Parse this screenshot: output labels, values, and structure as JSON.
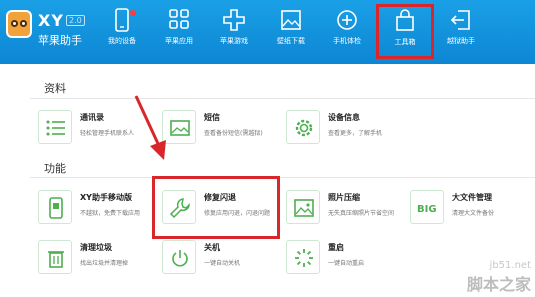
{
  "brand": {
    "name": "XY",
    "version": "2.0",
    "subtitle": "苹果助手"
  },
  "nav": [
    {
      "label": "我的设备",
      "icon": "device-icon"
    },
    {
      "label": "苹果应用",
      "icon": "apps-grid-icon"
    },
    {
      "label": "苹果游戏",
      "icon": "game-cross-icon"
    },
    {
      "label": "壁纸下载",
      "icon": "wallpaper-icon"
    },
    {
      "label": "手机体检",
      "icon": "health-check-icon"
    },
    {
      "label": "工具箱",
      "icon": "toolbox-icon",
      "active": true
    },
    {
      "label": "越狱助手",
      "icon": "jailbreak-exit-icon"
    }
  ],
  "sections": {
    "data_title": "资料",
    "function_title": "功能"
  },
  "tools": {
    "contacts": {
      "name": "通讯录",
      "desc": "轻松管理手机联系人",
      "icon": "contacts-list-icon"
    },
    "sms": {
      "name": "短信",
      "desc": "查看备份短信(需越狱)",
      "icon": "sms-image-icon"
    },
    "device_info": {
      "name": "设备信息",
      "desc": "查看更多，了解手机",
      "icon": "gear-icon"
    },
    "xy_mobile": {
      "name": "XY助手移动版",
      "desc": "不越狱，免费下载应用",
      "icon": "mobile-app-icon"
    },
    "repair_crash": {
      "name": "修复闪退",
      "desc": "修复应用闪退，闪退问题",
      "icon": "wrench-icon"
    },
    "photo_compress": {
      "name": "照片压缩",
      "desc": "无失真压缩照片节省空间",
      "icon": "photo-icon"
    },
    "big_file": {
      "name": "大文件管理",
      "desc": "清理大文件备份",
      "icon": "big-badge-icon",
      "badge": "BIG"
    },
    "clean_junk": {
      "name": "清理垃圾",
      "desc": "找出垃圾并清理掉",
      "icon": "trash-icon"
    },
    "shutdown": {
      "name": "关机",
      "desc": "一键自动关机",
      "icon": "power-icon"
    },
    "restart": {
      "name": "重启",
      "desc": "一键自动重启",
      "icon": "restart-icon"
    }
  },
  "watermark": {
    "site": "jb51.net",
    "text": "脚本之家"
  },
  "colors": {
    "header_blue": "#1aa0e6",
    "accent_green": "#4caf50",
    "highlight_red": "#d9262b"
  }
}
